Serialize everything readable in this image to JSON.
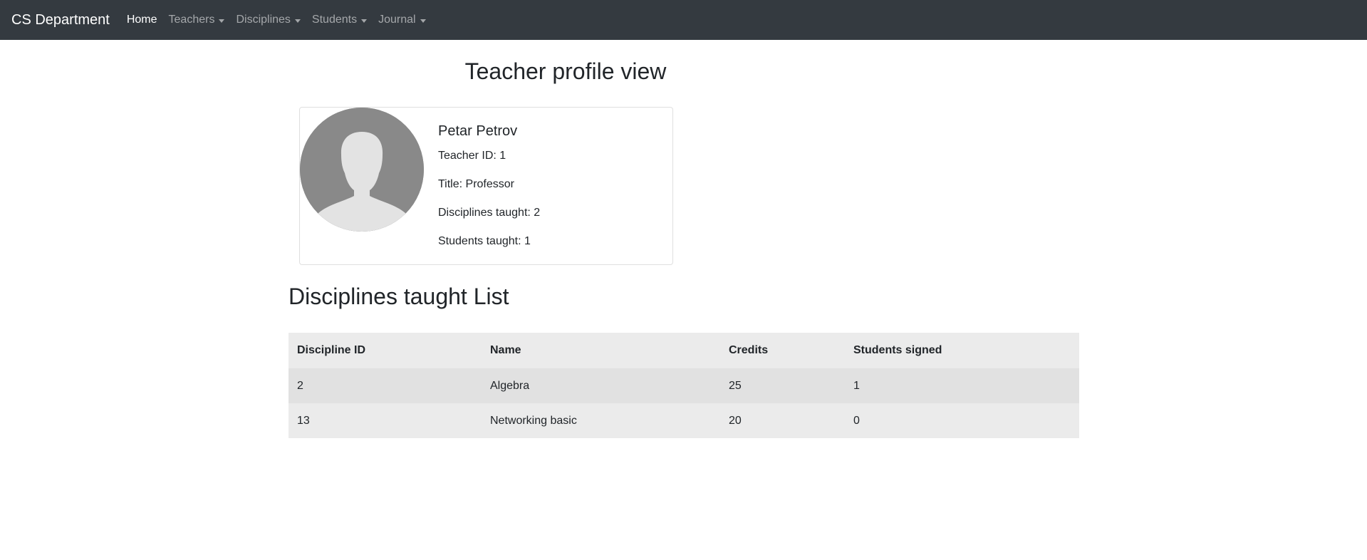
{
  "navbar": {
    "brand": "CS Department",
    "items": [
      {
        "label": "Home",
        "dropdown": false,
        "active": true
      },
      {
        "label": "Teachers",
        "dropdown": true,
        "active": false
      },
      {
        "label": "Disciplines",
        "dropdown": true,
        "active": false
      },
      {
        "label": "Students",
        "dropdown": true,
        "active": false
      },
      {
        "label": "Journal",
        "dropdown": true,
        "active": false
      }
    ]
  },
  "page": {
    "title": "Teacher profile view"
  },
  "profile": {
    "avatar_icon": "user-silhouette-icon",
    "name": "Petar Petrov",
    "teacher_id": "Teacher ID: 1",
    "title": "Title: Professor",
    "disciplines_taught": "Disciplines taught: 2",
    "students_taught": "Students taught: 1"
  },
  "disciplines": {
    "heading": "Disciplines taught List",
    "columns": [
      "Discipline ID",
      "Name",
      "Credits",
      "Students signed"
    ],
    "rows": [
      [
        "2",
        "Algebra",
        "25",
        "1"
      ],
      [
        "13",
        "Networking basic",
        "20",
        "0"
      ]
    ]
  },
  "colors": {
    "navbar_bg": "#343a40",
    "table_header_bg": "#ebebeb",
    "table_row_odd_bg": "#e1e1e1",
    "avatar_bg": "#898989"
  }
}
